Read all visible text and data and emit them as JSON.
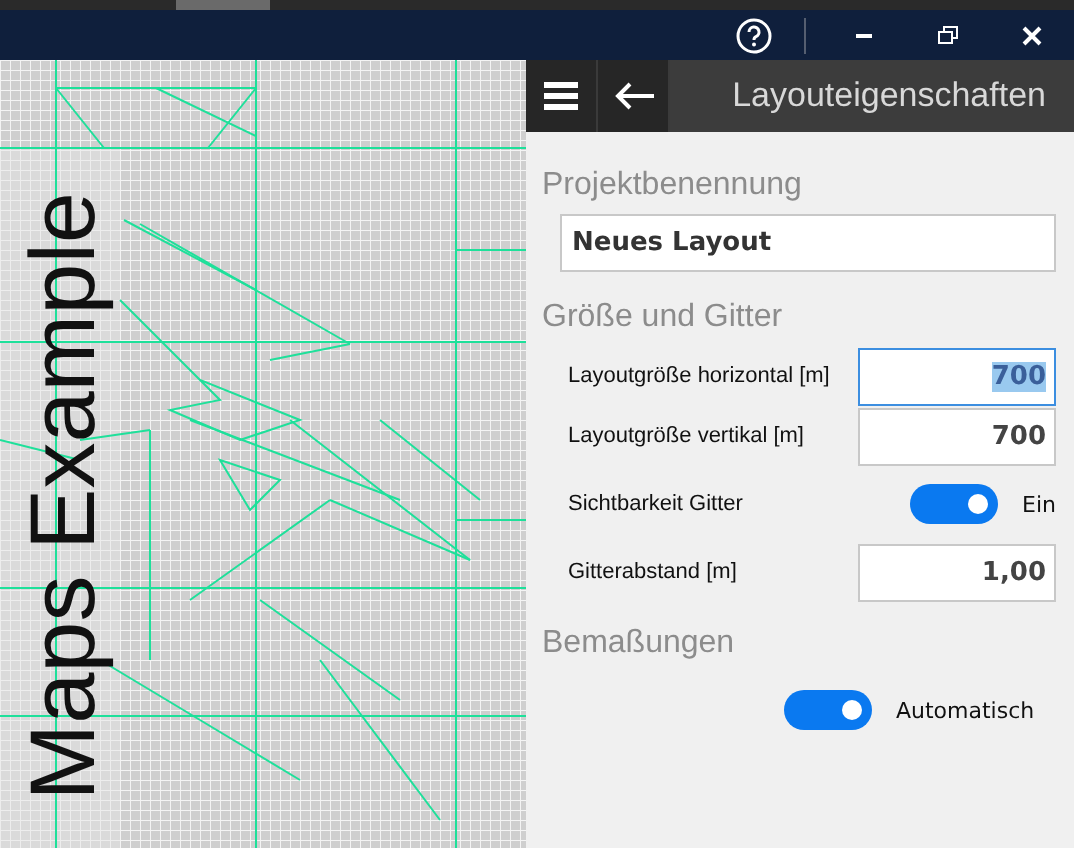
{
  "canvas": {
    "label": "Maps Example"
  },
  "panel": {
    "title": "Layouteigenschaften",
    "sections": [
      {
        "heading": "Projektbenennung",
        "rows": [
          {
            "kind": "name",
            "value": "Neues Layout"
          }
        ]
      },
      {
        "heading": "Größe und Gitter",
        "rows": [
          {
            "kind": "field",
            "label": "Layoutgröße horizontal [m]",
            "value": "700",
            "focused": true
          },
          {
            "kind": "field",
            "label": "Layoutgröße vertikal [m]",
            "value": "700",
            "focused": false
          },
          {
            "kind": "toggle",
            "label": "Sichtbarkeit Gitter",
            "on": true,
            "state_text": "Ein"
          },
          {
            "kind": "field",
            "label": "Gitterabstand [m]",
            "value": "1,00",
            "focused": false
          }
        ]
      },
      {
        "heading": "Bemaßungen",
        "rows": [
          {
            "kind": "toggle",
            "on": true,
            "state_text": "Automatisch"
          }
        ]
      }
    ]
  }
}
